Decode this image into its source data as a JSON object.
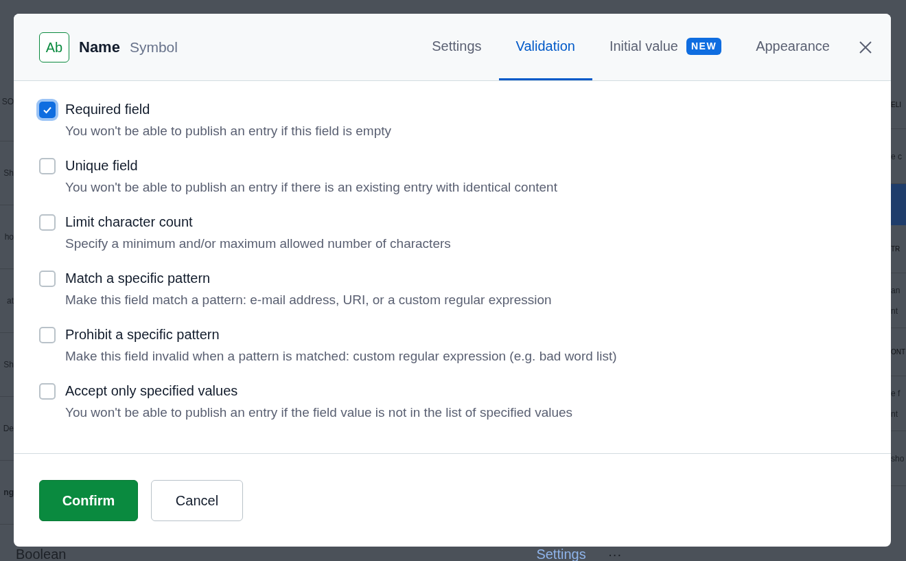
{
  "background": {
    "left_fragments": [
      {
        "text": "SO",
        "bold": false
      },
      {
        "text": "Sh",
        "bold": false
      },
      {
        "text": "ho",
        "bold": false
      },
      {
        "text": "at",
        "bold": false
      },
      {
        "text": "Sh",
        "bold": false
      },
      {
        "text": "De",
        "bold": false
      },
      {
        "text": "ng",
        "bold": true
      }
    ],
    "right_fragments": [
      {
        "kind": "heading",
        "text": "ELI"
      },
      {
        "kind": "text",
        "text": "e c"
      },
      {
        "kind": "band"
      },
      {
        "kind": "heading",
        "text": "TR"
      },
      {
        "kind": "text",
        "text": "an\nnt"
      },
      {
        "kind": "heading",
        "text": "ONT"
      },
      {
        "kind": "text",
        "text": "e f\nnt"
      },
      {
        "kind": "text",
        "text": "sho"
      }
    ],
    "bottom_row": {
      "type": "Boolean",
      "link": "Settings",
      "more": "···"
    }
  },
  "dialog": {
    "field_icon": "Ab",
    "field_name": "Name",
    "field_type": "Symbol",
    "tabs": [
      {
        "label": "Settings",
        "selected": false
      },
      {
        "label": "Validation",
        "selected": true
      },
      {
        "label": "Initial value",
        "selected": false,
        "badge": "NEW"
      },
      {
        "label": "Appearance",
        "selected": false
      }
    ],
    "validations": [
      {
        "title": "Required field",
        "description": "You won't be able to publish an entry if this field is empty",
        "checked": true
      },
      {
        "title": "Unique field",
        "description": "You won't be able to publish an entry if there is an existing entry with identical content",
        "checked": false
      },
      {
        "title": "Limit character count",
        "description": "Specify a minimum and/or maximum allowed number of characters",
        "checked": false
      },
      {
        "title": "Match a specific pattern",
        "description": "Make this field match a pattern: e-mail address, URI, or a custom regular expression",
        "checked": false
      },
      {
        "title": "Prohibit a specific pattern",
        "description": "Make this field invalid when a pattern is matched: custom regular expression (e.g. bad word list)",
        "checked": false
      },
      {
        "title": "Accept only specified values",
        "description": "You won't be able to publish an entry if the field value is not in the list of specified values",
        "checked": false
      }
    ],
    "buttons": [
      {
        "label": "Confirm",
        "kind": "primary"
      },
      {
        "label": "Cancel",
        "kind": "secondary"
      }
    ]
  }
}
